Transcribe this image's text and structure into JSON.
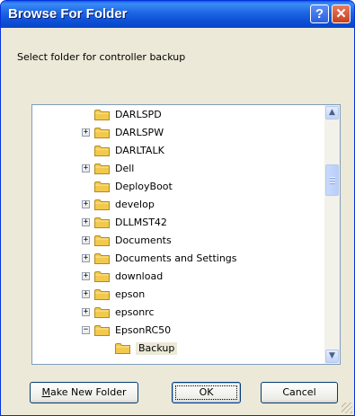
{
  "window": {
    "title": "Browse For Folder",
    "help_glyph": "?",
    "close_glyph": "✕"
  },
  "instruction": "Select folder for controller backup",
  "tree": {
    "items": [
      {
        "label": "DARLSPD",
        "expander": "",
        "selected": false
      },
      {
        "label": "DARLSPW",
        "expander": "+",
        "selected": false
      },
      {
        "label": "DARLTALK",
        "expander": "",
        "selected": false
      },
      {
        "label": "Dell",
        "expander": "+",
        "selected": false
      },
      {
        "label": "DeployBoot",
        "expander": "",
        "selected": false
      },
      {
        "label": "develop",
        "expander": "+",
        "selected": false
      },
      {
        "label": "DLLMST42",
        "expander": "+",
        "selected": false
      },
      {
        "label": "Documents",
        "expander": "+",
        "selected": false
      },
      {
        "label": "Documents and Settings",
        "expander": "+",
        "selected": false
      },
      {
        "label": "download",
        "expander": "+",
        "selected": false
      },
      {
        "label": "epson",
        "expander": "+",
        "selected": false
      },
      {
        "label": "epsonrc",
        "expander": "+",
        "selected": false
      },
      {
        "label": "EpsonRC50",
        "expander": "−",
        "selected": false
      },
      {
        "label": "Backup",
        "expander": "",
        "selected": true
      }
    ]
  },
  "scrollbar": {
    "up_glyph": "▲",
    "down_glyph": "▼"
  },
  "buttons": {
    "new_folder_prefix": "M",
    "new_folder_rest": "ake New Folder",
    "ok": "OK",
    "cancel": "Cancel"
  },
  "colors": {
    "titlebar": "#0A5EE8",
    "selection": "#316AC5",
    "dialog_bg": "#ECE9D8",
    "folder": "#F2C94C"
  }
}
